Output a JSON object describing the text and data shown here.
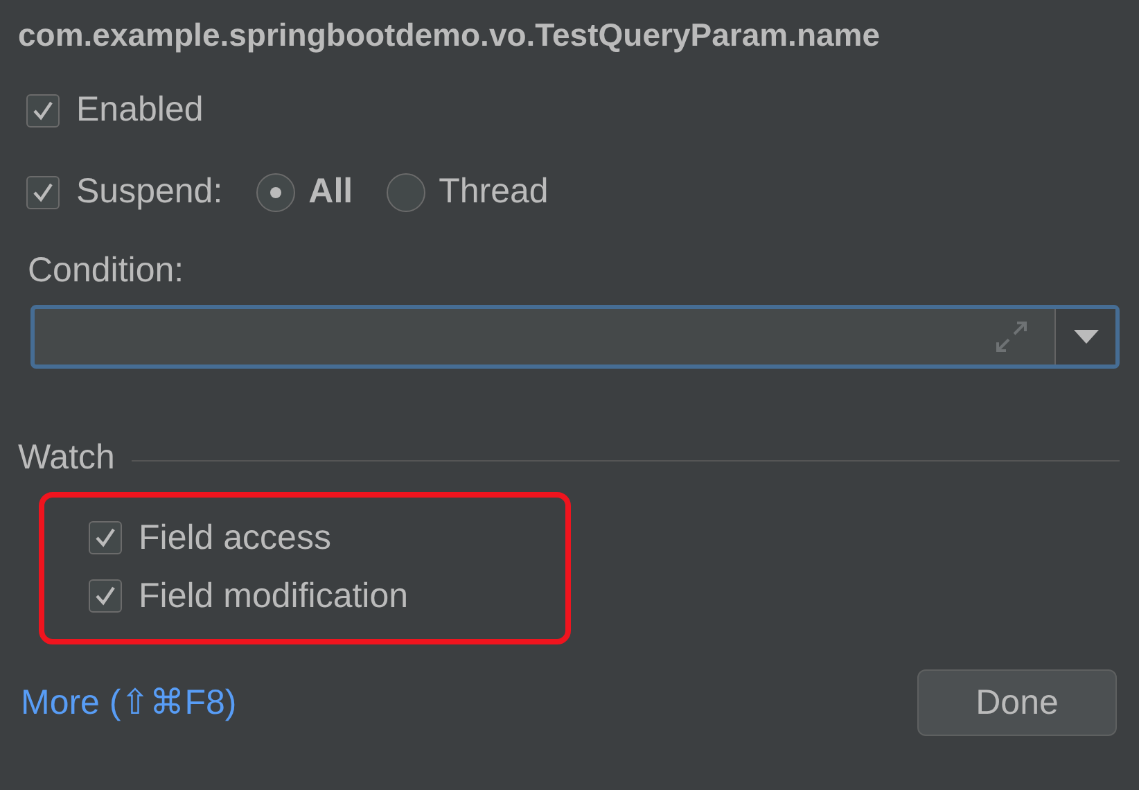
{
  "title": "com.example.springbootdemo.vo.TestQueryParam.name",
  "enabled": {
    "label": "Enabled",
    "checked": true
  },
  "suspend": {
    "label": "Suspend:",
    "checked": true,
    "options": [
      {
        "label": "All",
        "selected": true
      },
      {
        "label": "Thread",
        "selected": false
      }
    ]
  },
  "condition": {
    "label": "Condition:"
  },
  "watch": {
    "title": "Watch",
    "highlighted": true,
    "items": [
      {
        "label": "Field access",
        "checked": true
      },
      {
        "label": "Field modification",
        "checked": true
      }
    ]
  },
  "more_link": "More (⇧⌘F8)",
  "done_button": "Done"
}
